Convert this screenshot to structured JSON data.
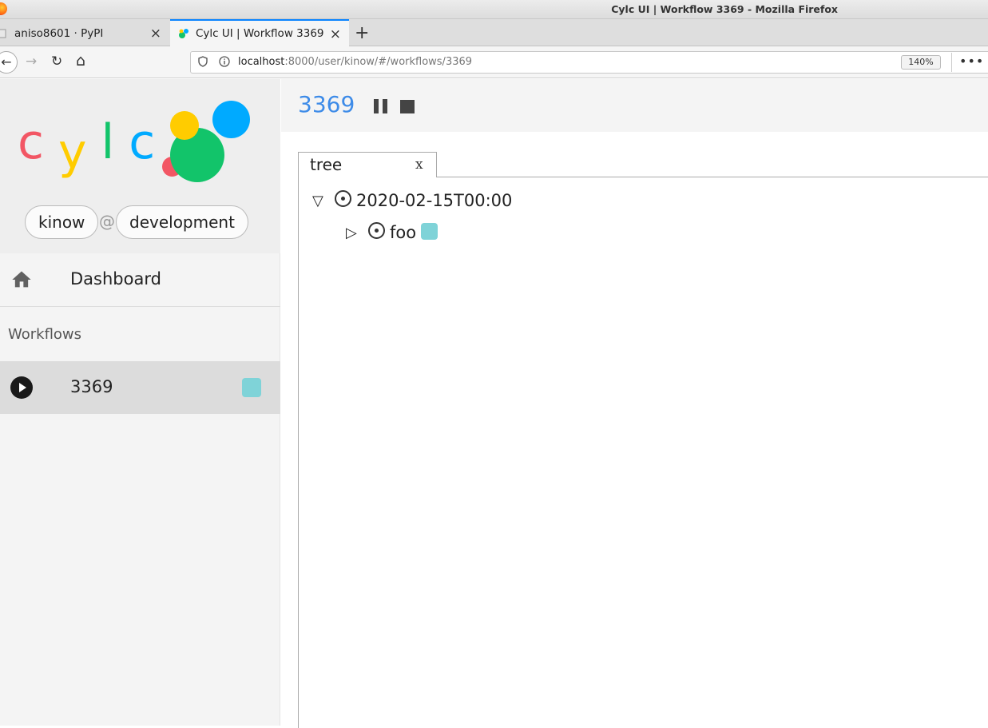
{
  "browser": {
    "window_title": "Cylc UI | Workflow 3369 - Mozilla Firefox",
    "tabs": [
      {
        "label": "aniso8601 · PyPI",
        "close": "×"
      },
      {
        "label": "Cylc UI | Workflow 3369",
        "close": "×"
      }
    ],
    "new_tab": "+",
    "url_host": "localhost",
    "url_path": ":8000/user/kinow/#/workflows/3369",
    "zoom": "140%",
    "more": "•••",
    "back": "←",
    "forward": "→",
    "reload": "↻",
    "home": "⌂"
  },
  "sidebar": {
    "logo": {
      "c1": "c",
      "y": "y",
      "l": "l",
      "c2": "c"
    },
    "user": "kinow",
    "at": "@",
    "server": "development",
    "dashboard_label": "Dashboard",
    "section_label": "Workflows",
    "workflows": [
      {
        "name": "3369",
        "status_color": "#7fd3d8"
      }
    ]
  },
  "toolbar": {
    "workflow_title": "3369"
  },
  "view": {
    "tab_label": "tree",
    "tab_close": "x",
    "tree": {
      "cycle_toggle": "▽",
      "cycle_point": "2020-02-15T00:00",
      "task_toggle": "▷",
      "task_name": "foo"
    }
  },
  "colors": {
    "accent": "#3d8be8",
    "job_status": "#7fd3d8",
    "logo_red": "#f25664",
    "logo_yellow": "#ffcc00",
    "logo_green": "#12c46a",
    "logo_blue": "#00aaff"
  }
}
